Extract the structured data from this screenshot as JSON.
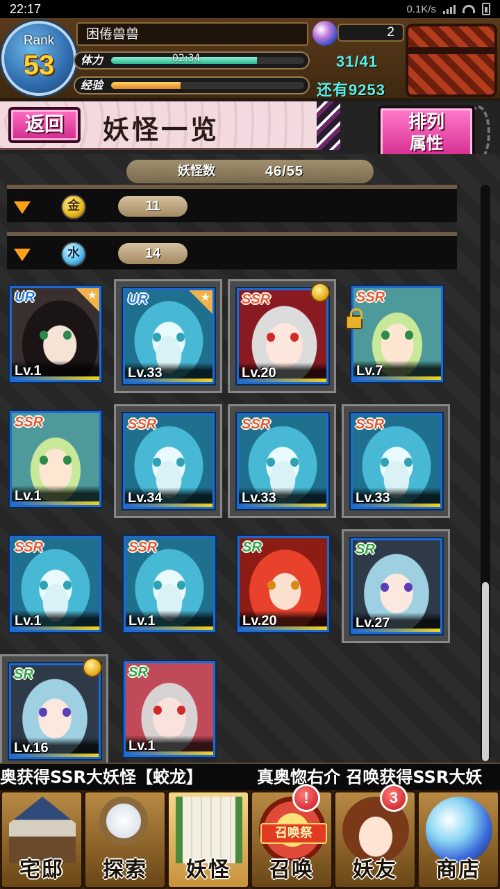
{
  "statusbar": {
    "time": "22:17",
    "speed": "0.1K/s"
  },
  "player": {
    "rank_label": "Rank",
    "rank": "53",
    "name": "困倦兽兽",
    "gems": "2",
    "stamina_label": "体力",
    "stamina_timer": "02:34",
    "stamina_value": "31/41",
    "stamina_fraction": 0.756,
    "exp_label": "经验",
    "exp_fraction": 0.36,
    "exp_remaining": "还有9253"
  },
  "page": {
    "back_label": "返回",
    "title": "妖怪一览",
    "sort_line1": "排列",
    "sort_line2": "属性"
  },
  "list": {
    "count_label": "妖怪数",
    "count_value": "46/55",
    "groups": [
      {
        "attribute": "金",
        "icon": "gold-attribute-icon",
        "count": "11"
      },
      {
        "attribute": "水",
        "icon": "water-attribute-icon",
        "count": "14"
      }
    ],
    "cards": [
      {
        "rarity": "UR",
        "level": "Lv.1",
        "art": "dark",
        "eyes": "green",
        "star": true
      },
      {
        "rarity": "UR",
        "level": "Lv.33",
        "art": "teal",
        "eyes": "teal",
        "star": true
      },
      {
        "rarity": "SSR",
        "level": "Lv.20",
        "art": "white",
        "eyes": "red",
        "medal": true
      },
      {
        "rarity": "SSR",
        "level": "Lv.7",
        "art": "horn",
        "eyes": "green",
        "lock": true
      },
      {
        "rarity": "SSR",
        "level": "Lv.1",
        "art": "horn",
        "eyes": "green"
      },
      {
        "rarity": "SSR",
        "level": "Lv.34",
        "art": "teal",
        "eyes": "teal"
      },
      {
        "rarity": "SSR",
        "level": "Lv.33",
        "art": "teal",
        "eyes": "teal"
      },
      {
        "rarity": "SSR",
        "level": "Lv.33",
        "art": "teal",
        "eyes": "teal"
      },
      {
        "rarity": "SSR",
        "level": "Lv.1",
        "art": "teal",
        "eyes": "teal"
      },
      {
        "rarity": "SSR",
        "level": "Lv.1",
        "art": "teal",
        "eyes": "teal"
      },
      {
        "rarity": "SR",
        "level": "Lv.20",
        "art": "red",
        "eyes": "amber"
      },
      {
        "rarity": "SR",
        "level": "Lv.27",
        "art": "silver",
        "eyes": "violet"
      },
      {
        "rarity": "SR",
        "level": "Lv.16",
        "art": "silver",
        "eyes": "violet",
        "medal": true
      },
      {
        "rarity": "SR",
        "level": "Lv.1",
        "art": "pink",
        "eyes": "red"
      }
    ]
  },
  "ticker": {
    "text_left": "奥获得SSR大妖怪【蛟龙】",
    "text_right": "真奥惚右介 召唤获得SSR大妖"
  },
  "nav": {
    "items": [
      {
        "label": "宅邸",
        "icon": "house-icon"
      },
      {
        "label": "探索",
        "icon": "magnifier-icon"
      },
      {
        "label": "妖怪",
        "icon": "scroll-icon"
      },
      {
        "label": "召唤",
        "icon": "summon-icon",
        "badge": "!",
        "tag": "召唤祭"
      },
      {
        "label": "妖友",
        "icon": "friend-icon",
        "badge": "3"
      },
      {
        "label": "商店",
        "icon": "orb-icon"
      }
    ]
  }
}
